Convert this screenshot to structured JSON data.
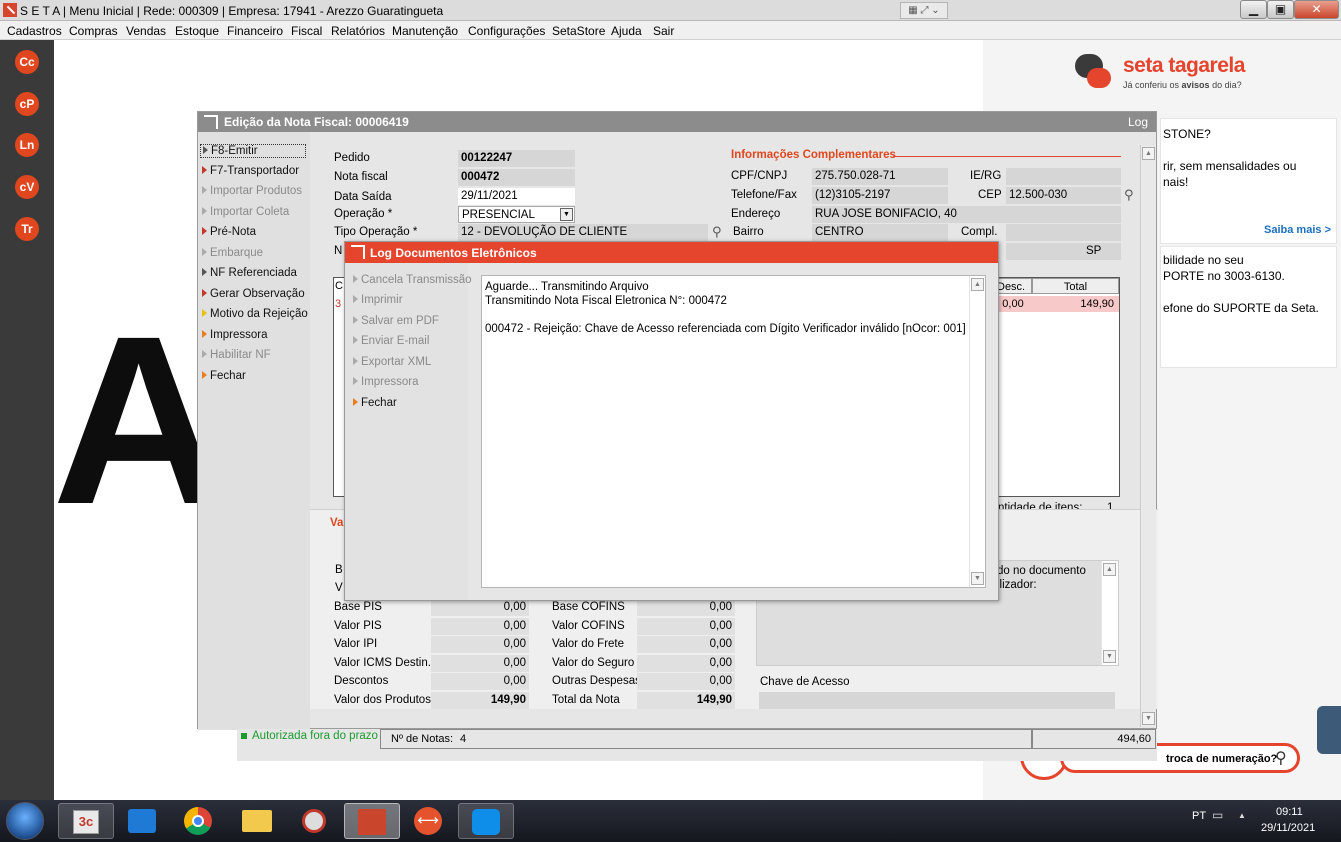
{
  "app": {
    "title": "S E T A | Menu Inicial | Rede: 000309 | Empresa: 17941 - Arezzo Guaratingueta"
  },
  "menubar": [
    "Cadastros",
    "Compras",
    "Vendas",
    "Estoque",
    "Financeiro",
    "Fiscal",
    "Relatórios",
    "Manutenção",
    "Configurações",
    "SetaStore",
    "Ajuda",
    "Sair"
  ],
  "dock": [
    "Cc",
    "cP",
    "Ln",
    "cV",
    "Tr"
  ],
  "background_letter": "A",
  "rightpanel": {
    "brand": "seta tagarela",
    "tagline_pre": "Já conferiu os ",
    "tagline_bold": "avisos",
    "tagline_post": " do dia?",
    "card1_l1": "STONE?",
    "card1_l2": "rir, sem mensalidades ou",
    "card1_l3": "nais!",
    "card1_link": "Saiba mais >",
    "card2_l1": "bilidade no seu",
    "card2_l2": "PORTE no 3003-6130.",
    "card2_l3": "efone do SUPORTE da Seta.",
    "search_text": "troca de numeração?"
  },
  "main": {
    "title": "Edição da Nota Fiscal: 00006419",
    "log_link": "Log",
    "menu": [
      {
        "label": "F8-Emitir",
        "state": "focused",
        "color": "dark"
      },
      {
        "label": "F7-Transportador",
        "state": "enabled",
        "color": "red"
      },
      {
        "label": "Importar Produtos",
        "state": "disabled",
        "color": "gray"
      },
      {
        "label": "Importar Coleta",
        "state": "disabled",
        "color": "gray"
      },
      {
        "label": "Pré-Nota",
        "state": "enabled",
        "color": "red"
      },
      {
        "label": "Embarque",
        "state": "disabled",
        "color": "gray"
      },
      {
        "label": "NF Referenciada",
        "state": "enabled",
        "color": "dark"
      },
      {
        "label": "Gerar Observação",
        "state": "enabled",
        "color": "red"
      },
      {
        "label": "Motivo da Rejeição",
        "state": "enabled",
        "color": "yellow"
      },
      {
        "label": "Impressora",
        "state": "enabled",
        "color": "orange"
      },
      {
        "label": "Habilitar NF",
        "state": "disabled",
        "color": "gray"
      },
      {
        "label": "Fechar",
        "state": "enabled",
        "color": "orange"
      }
    ],
    "fields": {
      "pedido_label": "Pedido",
      "pedido": "00122247",
      "nota_label": "Nota fiscal",
      "nota": "000472",
      "data_label": "Data Saída",
      "data": "29/11/2021",
      "operacao_label": "Operação *",
      "operacao": "PRESENCIAL",
      "tipo_label": "Tipo Operação *",
      "tipo": "12 - DEVOLUÇÃO DE CLIENTE",
      "n_label": "N"
    },
    "info": {
      "section": "Informações Complementares",
      "cpf_label": "CPF/CNPJ",
      "cpf": "275.750.028-71",
      "ie_label": "IE/RG",
      "ie": "",
      "tel_label": "Telefone/Fax",
      "tel": "(12)3105-2197",
      "cep_label": "CEP",
      "cep": "12.500-030",
      "end_label": "Endereço",
      "end": "RUA JOSE BONIFACIO, 40",
      "bairro_label": "Bairro",
      "bairro": "CENTRO",
      "compl_label": "Compl.",
      "compl": "",
      "uf": "SP"
    },
    "grid": {
      "col_c": "C",
      "col_desc": "Desc.",
      "col_total": "Total",
      "row_first": "3",
      "row_desc": "0,00",
      "row_total": "149,90",
      "qtd_label": "ntidade de itens:",
      "qtd": "1"
    },
    "values_section": "Va",
    "b_label": "B",
    "v_label": "V",
    "totals": [
      {
        "l1": "Base PIS",
        "v1": "0,00",
        "l2": "Base COFINS",
        "v2": "0,00"
      },
      {
        "l1": "Valor PIS",
        "v1": "0,00",
        "l2": "Valor COFINS",
        "v2": "0,00"
      },
      {
        "l1": "Valor IPI",
        "v1": "0,00",
        "l2": "Valor do Frete",
        "v2": "0,00"
      },
      {
        "l1": "Valor ICMS Destin.",
        "v1": "0,00",
        "l2": "Valor do Seguro",
        "v2": "0,00"
      },
      {
        "l1": "Descontos",
        "v1": "0,00",
        "l2": "Outras Despesas",
        "v2": "0,00"
      },
      {
        "l1": "Valor dos Produtos",
        "v1": "149,90",
        "l2": "Total da Nota",
        "v2": "149,90"
      }
    ],
    "obs_l1": "do no documento",
    "obs_l2": "ilizador:",
    "chave_label": "Chave de Acesso",
    "chave": ""
  },
  "status": {
    "authorized": "Autorizada fora do prazo",
    "notas_label": "Nº de Notas:",
    "notas": "4",
    "total": "494,60"
  },
  "log": {
    "title": "Log Documentos Eletrônicos",
    "menu": [
      {
        "label": "Cancela Transmissão",
        "state": "disabled"
      },
      {
        "label": "Imprimir",
        "state": "disabled"
      },
      {
        "label": "Salvar em PDF",
        "state": "disabled"
      },
      {
        "label": "Enviar E-mail",
        "state": "disabled"
      },
      {
        "label": "Exportar XML",
        "state": "disabled"
      },
      {
        "label": "Impressora",
        "state": "disabled"
      },
      {
        "label": "Fechar",
        "state": "enabled"
      }
    ],
    "lines": [
      "Aguarde... Transmitindo Arquivo",
      "Transmitindo Nota Fiscal Eletronica N°: 000472",
      "",
      "000472 - Rejeição: Chave de Acesso referenciada com Dígito Verificador inválido [nOcor: 001]"
    ]
  },
  "taskbar": {
    "lang": "PT",
    "time": "09:11",
    "date": "29/11/2021"
  },
  "colors": {
    "accent": "#e5442d",
    "title_gray": "#8c8c8c",
    "dock": "#3a3a3a"
  }
}
